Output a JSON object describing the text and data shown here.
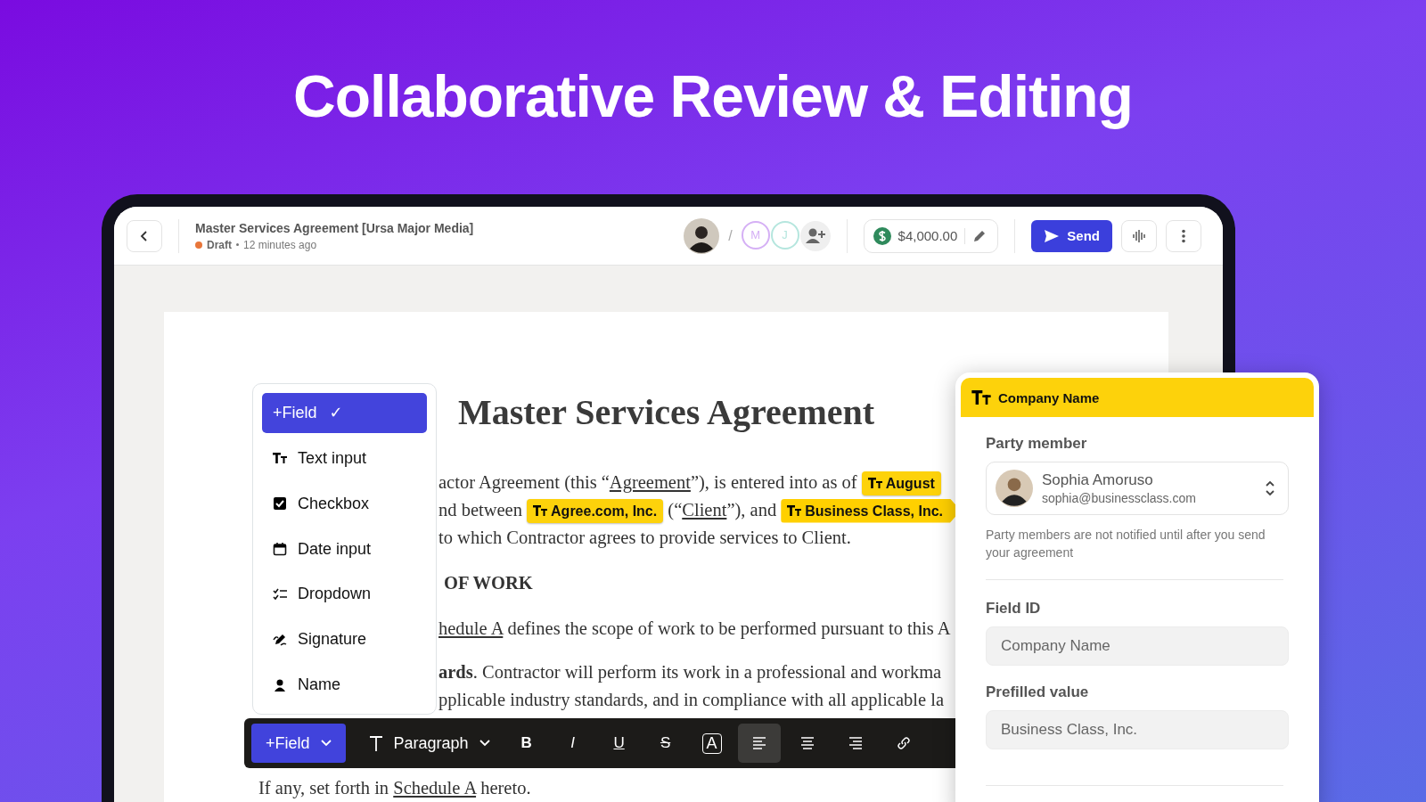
{
  "headline": "Collaborative Review & Editing",
  "header": {
    "title": "Master Services Agreement [Ursa Major Media]",
    "status": {
      "label": "Draft",
      "color": "#e8763a"
    },
    "updated": "12 minutes ago",
    "separator": "/",
    "collaborators": [
      {
        "initial": "M",
        "color": "#d5b0f5"
      },
      {
        "initial": "J",
        "color": "#b5e6de"
      }
    ],
    "amount": "$4,000.00",
    "send_label": "Send"
  },
  "document": {
    "title": "Master Services Agreement",
    "lines": [
      {
        "kind": "text",
        "segments": [
          {
            "kind": "text",
            "text": "actor Agreement (this “"
          },
          {
            "kind": "link",
            "text": "Agreement"
          },
          {
            "kind": "text",
            "text": "”), is entered into as of "
          },
          {
            "kind": "chip",
            "text": "August",
            "selected": false
          }
        ]
      },
      {
        "kind": "text",
        "segments": [
          {
            "kind": "text",
            "text": "nd between "
          },
          {
            "kind": "chip",
            "text": "Agree.com, Inc.",
            "selected": false
          },
          {
            "kind": "text",
            "text": " (“"
          },
          {
            "kind": "link",
            "text": "Client"
          },
          {
            "kind": "text",
            "text": "”), and "
          },
          {
            "kind": "chip",
            "text": "Business Class, Inc.",
            "selected": true
          }
        ]
      },
      {
        "kind": "text",
        "segments": [
          {
            "kind": "text",
            "text": "to which Contractor agrees to provide services to Client."
          }
        ]
      },
      {
        "kind": "heading",
        "segments": [
          {
            "kind": "bold",
            "text": "OF WORK"
          }
        ]
      },
      {
        "kind": "text",
        "segments": [
          {
            "kind": "link",
            "text": "hedule A"
          },
          {
            "kind": "text",
            "text": " defines the scope of work to be performed pursuant to this A"
          }
        ]
      },
      {
        "kind": "text",
        "segments": [
          {
            "kind": "bold",
            "text": "ards"
          },
          {
            "kind": "text",
            "text": ". Contractor will perform its work in a professional and workma"
          }
        ]
      },
      {
        "kind": "text",
        "segments": [
          {
            "kind": "text",
            "text": "pplicable industry standards, and in compliance with all applicable la"
          }
        ]
      },
      {
        "kind": "tail",
        "segments": [
          {
            "kind": "text",
            "text": "If any, set forth in "
          },
          {
            "kind": "link",
            "text": "Schedule A"
          },
          {
            "kind": "text",
            "text": " hereto."
          }
        ]
      }
    ]
  },
  "field_menu": [
    {
      "kind": "field",
      "label": "+Field",
      "mark": "✓",
      "selected": true
    },
    {
      "kind": "text",
      "label": "Text input",
      "selected": false
    },
    {
      "kind": "checkbox",
      "label": "Checkbox",
      "selected": false
    },
    {
      "kind": "date",
      "label": "Date input",
      "selected": false
    },
    {
      "kind": "dropdown",
      "label": "Dropdown",
      "selected": false
    },
    {
      "kind": "signature",
      "label": "Signature",
      "selected": false
    },
    {
      "kind": "name",
      "label": "Name",
      "selected": false
    }
  ],
  "toolbar": {
    "field_label": "+Field",
    "style_label": "Paragraph",
    "format": [
      {
        "kind": "bold",
        "glyph": "B"
      },
      {
        "kind": "italic",
        "glyph": "I"
      },
      {
        "kind": "underline",
        "glyph": "U"
      },
      {
        "kind": "strike",
        "glyph": "S"
      },
      {
        "kind": "boxed",
        "glyph": "A"
      }
    ],
    "align": [
      {
        "kind": "left",
        "selected": true
      },
      {
        "kind": "center",
        "selected": false
      },
      {
        "kind": "right",
        "selected": false
      }
    ]
  },
  "panel": {
    "title": "Company Name",
    "party_label": "Party member",
    "member": {
      "name": "Sophia Amoruso",
      "email": "sophia@businessclass.com"
    },
    "hint": "Party members are not notified until after you send your agreement",
    "field_id_label": "Field ID",
    "field_id": "Company Name",
    "prefill_label": "Prefilled value",
    "prefill": "Business Class, Inc."
  }
}
